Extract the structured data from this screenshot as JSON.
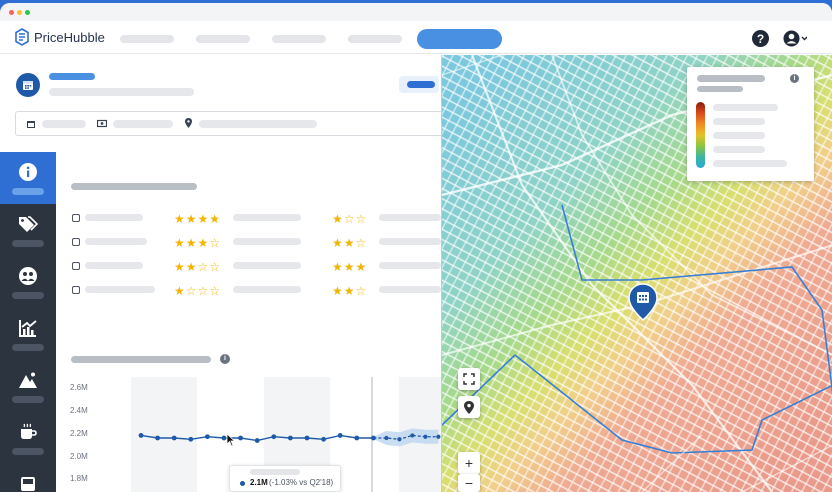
{
  "brand": {
    "name": "PriceHubble"
  },
  "topbar": {
    "help_icon": "question-circle-icon",
    "user_icon": "user-circle-icon"
  },
  "ratings": [
    {
      "icon": "washbasin-icon",
      "left_stars": 4,
      "right_stars": 1
    },
    {
      "icon": "bathtub-icon",
      "left_stars": 3,
      "right_stars": 2
    },
    {
      "icon": "layers-icon",
      "left_stars": 2,
      "right_stars": 3
    },
    {
      "icon": "building-icon",
      "left_stars": 1,
      "right_stars": 2
    }
  ],
  "chart_data": {
    "type": "line",
    "y_ticks": [
      "2.6M",
      "2.4M",
      "2.2M",
      "2.0M",
      "1.8M"
    ],
    "ylim": [
      1.8,
      2.6
    ],
    "series": [
      {
        "values": [
          2.22,
          2.2,
          2.2,
          2.19,
          2.21,
          2.2,
          2.2,
          2.18,
          2.21,
          2.2,
          2.2,
          2.19,
          2.22,
          2.2,
          2.2
        ]
      }
    ],
    "forecast": [
      2.2,
      2.19,
      2.22,
      2.21,
      2.21
    ],
    "tooltip": {
      "value": "2.1M",
      "change": "(-1.03% vs Q2'18)"
    }
  },
  "map": {
    "zoom_in": "+",
    "zoom_out": "−",
    "legend_colors": [
      "#8b1a0e",
      "#d94a1c",
      "#f08a24",
      "#e6c229",
      "#8cc63f",
      "#3cb6a0",
      "#2aa7d8"
    ]
  }
}
